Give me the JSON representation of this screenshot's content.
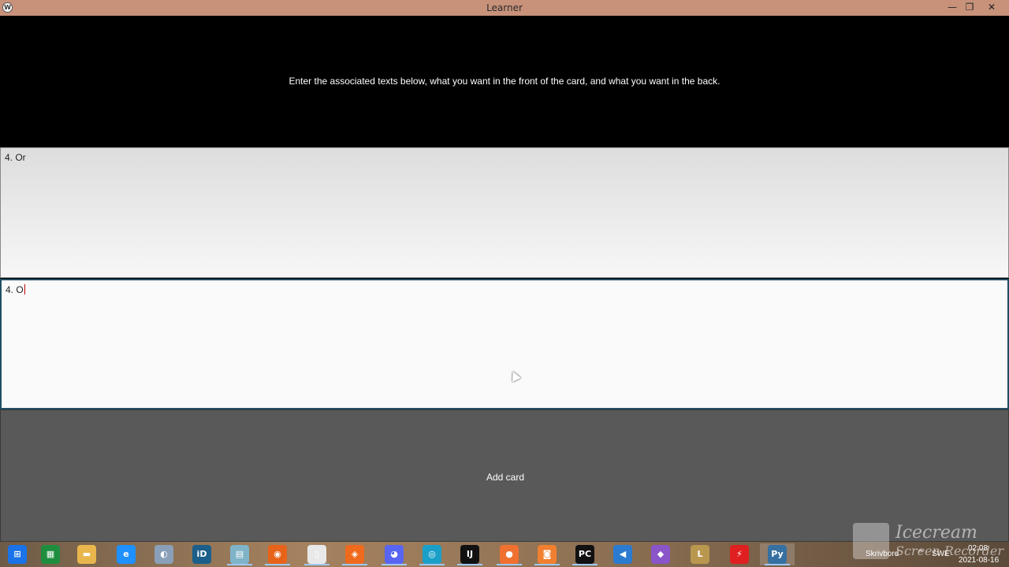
{
  "window": {
    "title": "Learner",
    "minimize": "—",
    "maximize": "❐",
    "close": "✕"
  },
  "header": {
    "instructions": "Enter the associated texts below, what you want in the front of the card, and what you want in the back."
  },
  "front_field": {
    "value": "4. Or"
  },
  "back_field": {
    "value": "4. O"
  },
  "add_button": {
    "label": "Add card"
  },
  "taskbar": {
    "items": [
      {
        "name": "windows-start-icon",
        "glyph": "⊞",
        "color": "#1a73e8"
      },
      {
        "name": "store-icon",
        "glyph": "▦",
        "color": "#1e8e3e"
      },
      {
        "name": "file-explorer-icon",
        "glyph": "▬",
        "color": "#e8b64c"
      },
      {
        "name": "internet-explorer-icon",
        "glyph": "e",
        "color": "#1e90ff"
      },
      {
        "name": "paint-icon",
        "glyph": "◐",
        "color": "#8aa0b8"
      },
      {
        "name": "bankid-icon",
        "glyph": "iD",
        "color": "#1b5f8a"
      },
      {
        "name": "notebook-icon",
        "glyph": "▤",
        "color": "#7fb4c8"
      },
      {
        "name": "firefox-icon",
        "glyph": "◉",
        "color": "#e8631a"
      },
      {
        "name": "blank-file-icon",
        "glyph": "▯",
        "color": "#e8e8e8"
      },
      {
        "name": "brave-icon",
        "glyph": "◈",
        "color": "#f06a1d"
      },
      {
        "name": "discord-icon",
        "glyph": "◕",
        "color": "#5865f2"
      },
      {
        "name": "edge-icon",
        "glyph": "◎",
        "color": "#1aa0c8"
      },
      {
        "name": "intellij-icon",
        "glyph": "IJ",
        "color": "#111111"
      },
      {
        "name": "screen-recorder-icon",
        "glyph": "●",
        "color": "#f07030"
      },
      {
        "name": "screenshot-icon",
        "glyph": "◙",
        "color": "#f08030"
      },
      {
        "name": "pycharm-icon",
        "glyph": "PC",
        "color": "#111111"
      },
      {
        "name": "vscode-icon",
        "glyph": "◀",
        "color": "#2b7bd0"
      },
      {
        "name": "visual-studio-icon",
        "glyph": "◆",
        "color": "#8a55c8"
      },
      {
        "name": "league-icon",
        "glyph": "L",
        "color": "#b9974e"
      },
      {
        "name": "bolt-icon",
        "glyph": "⚡",
        "color": "#e02020"
      },
      {
        "name": "python-icon",
        "glyph": "Py",
        "color": "#3670a0"
      }
    ]
  },
  "tray": {
    "desktop_label": "Skrivbord",
    "language": "SWE",
    "time": "02:08",
    "date": "2021-08-16"
  },
  "watermark": {
    "line1": "Icecream",
    "line2": "Screen Recorder"
  }
}
